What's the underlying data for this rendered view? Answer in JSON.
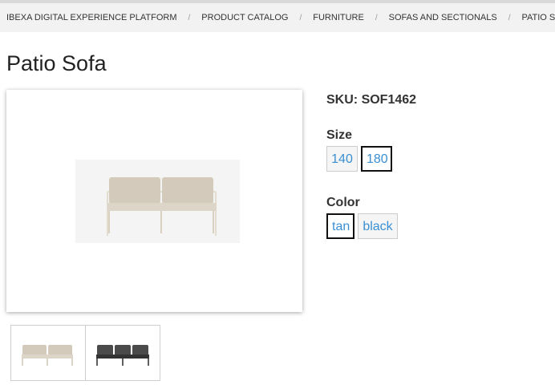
{
  "breadcrumb": [
    {
      "label": "IBEXA DIGITAL EXPERIENCE PLATFORM"
    },
    {
      "label": "PRODUCT CATALOG"
    },
    {
      "label": "FURNITURE"
    },
    {
      "label": "SOFAS AND SECTIONALS"
    },
    {
      "label": "PATIO SOFA"
    }
  ],
  "breadcrumb_separator": "/",
  "product": {
    "title": "Patio Sofa",
    "sku_label": "SKU:",
    "sku": "SOF1462",
    "size_label": "Size",
    "sizes": [
      {
        "label": "140",
        "selected": false
      },
      {
        "label": "180",
        "selected": true
      }
    ],
    "color_label": "Color",
    "colors": [
      {
        "label": "tan",
        "selected": true
      },
      {
        "label": "black",
        "selected": false
      }
    ]
  },
  "images": {
    "main": {
      "icon": "sofa-tan-image"
    },
    "thumbnails": [
      {
        "icon": "sofa-tan-thumbnail"
      },
      {
        "icon": "sofa-black-thumbnail"
      }
    ]
  },
  "colors": {
    "link": "#3a8fd4",
    "selected_border": "#111111",
    "breadcrumb_bg": "#f2f2f2"
  }
}
